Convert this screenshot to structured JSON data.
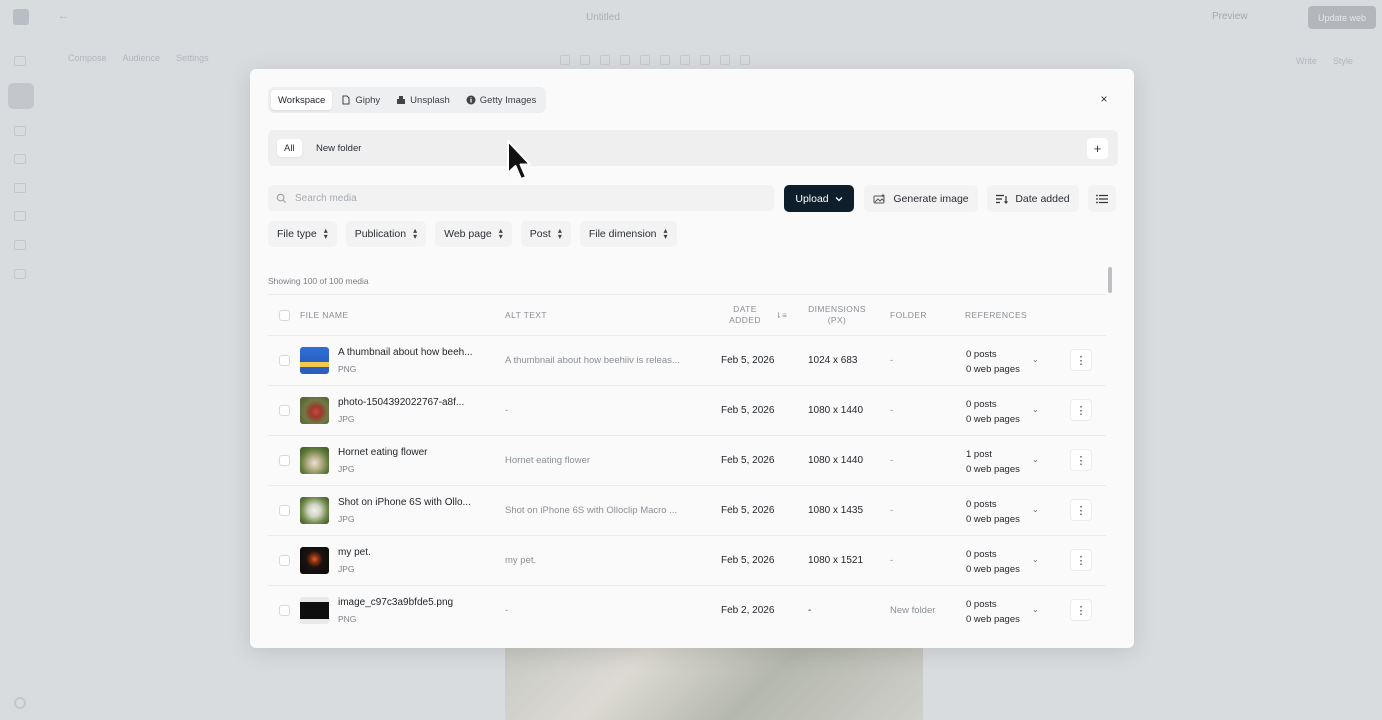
{
  "app": {
    "back_label": "←",
    "doc_title": "Untitled",
    "preview_label": "Preview",
    "update_label": "Update web",
    "bg_tabs": [
      "Compose",
      "Audience",
      "Settings"
    ],
    "bg_right_tabs": [
      "Write",
      "Style"
    ]
  },
  "modal": {
    "source_tabs": [
      {
        "label": "Workspace",
        "icon": "none"
      },
      {
        "label": "Giphy",
        "icon": "file-icon"
      },
      {
        "label": "Unsplash",
        "icon": "camera-icon"
      },
      {
        "label": "Getty Images",
        "icon": "info-circle-icon"
      }
    ],
    "close_label": "×",
    "folders": [
      "All",
      "New folder"
    ],
    "add_folder_label": "+",
    "search_placeholder": "Search media",
    "upload_label": "Upload",
    "generate_label": "Generate image",
    "sort_label": "Date added",
    "filters": [
      "File type",
      "Publication",
      "Web page",
      "Post",
      "File dimension"
    ],
    "showing_text": "Showing 100 of 100 media",
    "columns": {
      "file_name": "FILE NAME",
      "alt_text": "ALT TEXT",
      "date_added_1": "DATE",
      "date_added_2": "ADDED",
      "dimensions_1": "DIMENSIONS",
      "dimensions_2": "(PX)",
      "folder": "FOLDER",
      "references": "REFERENCES"
    },
    "rows": [
      {
        "name": "A thumbnail about how beeh...",
        "type": "PNG",
        "alt": "A thumbnail about how beehiiv is releas...",
        "date": "Feb 5, 2026",
        "dims": "1024 x 683",
        "folder": "-",
        "posts": "0 posts",
        "pages": "0 web pages"
      },
      {
        "name": "photo-1504392022767-a8f...",
        "type": "JPG",
        "alt": "-",
        "date": "Feb 5, 2026",
        "dims": "1080 x 1440",
        "folder": "-",
        "posts": "0 posts",
        "pages": "0 web pages"
      },
      {
        "name": "Hornet eating flower",
        "type": "JPG",
        "alt": "Hornet eating flower",
        "date": "Feb 5, 2026",
        "dims": "1080 x 1440",
        "folder": "-",
        "posts": "1 post",
        "pages": "0 web pages"
      },
      {
        "name": "Shot on iPhone 6S with Ollo...",
        "type": "JPG",
        "alt": "Shot on iPhone 6S with Olloclip Macro ...",
        "date": "Feb 5, 2026",
        "dims": "1080 x 1435",
        "folder": "-",
        "posts": "0 posts",
        "pages": "0 web pages"
      },
      {
        "name": "my pet.",
        "type": "JPG",
        "alt": "my pet.",
        "date": "Feb 5, 2026",
        "dims": "1080 x 1521",
        "folder": "-",
        "posts": "0 posts",
        "pages": "0 web pages"
      },
      {
        "name": "image_c97c3a9bfde5.png",
        "type": "PNG",
        "alt": "-",
        "date": "Feb 2, 2026",
        "dims": "-",
        "folder": "New folder",
        "posts": "0 posts",
        "pages": "0 web pages"
      }
    ]
  }
}
